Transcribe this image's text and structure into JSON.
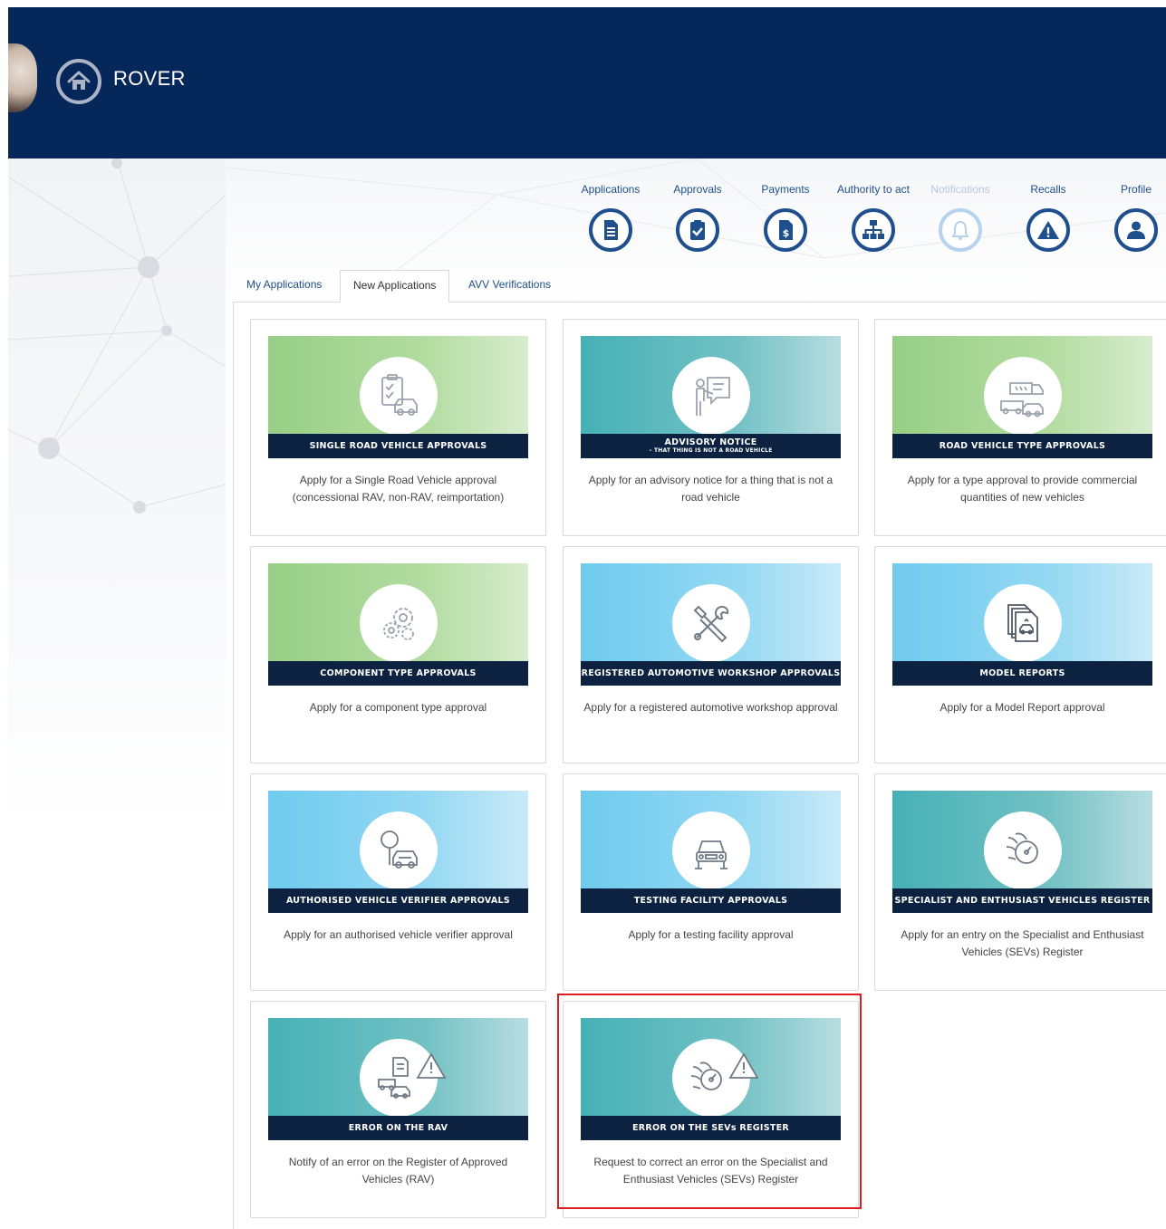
{
  "header": {
    "app_title": "ROVER"
  },
  "topnav": [
    {
      "label": "Applications",
      "icon": "applications-icon",
      "enabled": true
    },
    {
      "label": "Approvals",
      "icon": "approvals-icon",
      "enabled": true
    },
    {
      "label": "Payments",
      "icon": "payments-icon",
      "enabled": true
    },
    {
      "label": "Authority to act",
      "icon": "authority-icon",
      "enabled": true
    },
    {
      "label": "Notifications",
      "icon": "bell-icon",
      "enabled": false
    },
    {
      "label": "Recalls",
      "icon": "warning-icon",
      "enabled": true
    },
    {
      "label": "Profile",
      "icon": "user-icon",
      "enabled": true
    }
  ],
  "tabs": [
    {
      "label": "My Applications",
      "active": false
    },
    {
      "label": "New Applications",
      "active": true
    },
    {
      "label": "AVV Verifications",
      "active": false
    }
  ],
  "cards": [
    {
      "title": "SINGLE ROAD VEHICLE APPROVALS",
      "subtitle": "",
      "description": "Apply for a Single Road Vehicle approval (concessional RAV, non-RAV, reimportation)",
      "icon": "clipboard-car-icon"
    },
    {
      "title": "ADVISORY NOTICE",
      "subtitle": "– THAT THING IS NOT A ROAD VEHICLE",
      "description": "Apply for an advisory notice for a thing that is not a road vehicle",
      "icon": "presenter-icon"
    },
    {
      "title": "ROAD VEHICLE TYPE APPROVALS",
      "subtitle": "",
      "description": "Apply for a type approval to provide commercial quantities of new vehicles",
      "icon": "vehicles-icon"
    },
    {
      "title": "COMPONENT TYPE APPROVALS",
      "subtitle": "",
      "description": "Apply for a component type approval",
      "icon": "gears-icon"
    },
    {
      "title": "REGISTERED AUTOMOTIVE WORKSHOP APPROVALS",
      "subtitle": "",
      "description": "Apply for a registered automotive workshop approval",
      "icon": "tools-icon"
    },
    {
      "title": "MODEL REPORTS",
      "subtitle": "",
      "description": "Apply for a Model Report approval",
      "icon": "report-icon"
    },
    {
      "title": "AUTHORISED VEHICLE VERIFIER APPROVALS",
      "subtitle": "",
      "description": "Apply for an authorised vehicle verifier approval",
      "icon": "magnifier-car-icon"
    },
    {
      "title": "TESTING FACILITY APPROVALS",
      "subtitle": "",
      "description": "Apply for a testing facility approval",
      "icon": "car-lift-icon"
    },
    {
      "title": "SPECIALIST AND ENTHUSIAST VEHICLES REGISTER",
      "subtitle": "",
      "description": "Apply for an entry on the Specialist and Enthusiast Vehicles (SEVs) Register",
      "icon": "speedometer-flame-icon"
    },
    {
      "title": "ERROR ON THE RAV",
      "subtitle": "",
      "description": "Notify of an error on the Register of Approved Vehicles (RAV)",
      "icon": "vehicles-warning-icon"
    },
    {
      "title": "ERROR ON THE SEVs REGISTER",
      "subtitle": "",
      "description": "Request to correct an error on the Specialist and Enthusiast Vehicles (SEVs) Register",
      "icon": "speedometer-warning-icon"
    }
  ],
  "colors": {
    "header": "#06275a",
    "accent": "#1f4f8c",
    "card_bar": "#0c2240",
    "highlight": "#e11b1b"
  }
}
